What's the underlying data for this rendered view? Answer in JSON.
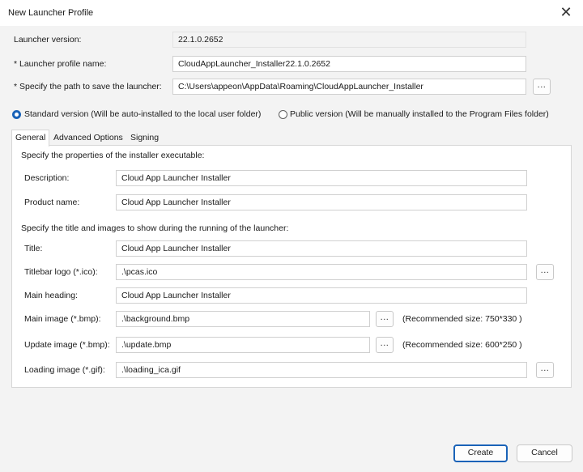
{
  "window": {
    "title": "New Launcher Profile",
    "close_glyph": "✕"
  },
  "form": {
    "launcher_version_label": "Launcher version:",
    "launcher_version_value": "22.1.0.2652",
    "profile_name_label": "* Launcher profile name:",
    "profile_name_value": "CloudAppLauncher_Installer22.1.0.2652",
    "save_path_label": "* Specify the path to save the launcher:",
    "save_path_value": "C:\\Users\\appeon\\AppData\\Roaming\\CloudAppLauncher_Installer",
    "browse_label": "..."
  },
  "version_options": {
    "standard": {
      "label": "Standard version (Will be auto-installed to the local user folder)",
      "selected": true
    },
    "public": {
      "label": "Public version (Will be manually installed to the Program Files folder)",
      "selected": false
    }
  },
  "tabs": [
    {
      "label": "General",
      "active": true
    },
    {
      "label": "Advanced Options",
      "active": false
    },
    {
      "label": "Signing",
      "active": false
    }
  ],
  "general": {
    "properties_heading": "Specify the properties of the installer executable:",
    "description_label": "Description:",
    "description_value": "Cloud App Launcher Installer",
    "product_name_label": "Product name:",
    "product_name_value": "Cloud App Launcher Installer",
    "images_heading": "Specify the title and images to show during the running of the launcher:",
    "title_label": "Title:",
    "title_value": "Cloud App Launcher Installer",
    "titlebar_logo_label": "Titlebar logo (*.ico):",
    "titlebar_logo_value": ".\\pcas.ico",
    "main_heading_label": "Main heading:",
    "main_heading_value": "Cloud App Launcher Installer",
    "main_image_label": "Main image (*.bmp):",
    "main_image_value": ".\\background.bmp",
    "main_image_hint": "(Recommended size: 750*330 )",
    "update_image_label": "Update image (*.bmp):",
    "update_image_value": ".\\update.bmp",
    "update_image_hint": "(Recommended size: 600*250 )",
    "loading_image_label": "Loading image (*.gif):",
    "loading_image_value": ".\\loading_ica.gif"
  },
  "buttons": {
    "create": "Create",
    "cancel": "Cancel"
  },
  "colors": {
    "accent": "#1a63b8",
    "window_bg": "#f3f3f3",
    "panel_bg": "#ffffff"
  }
}
